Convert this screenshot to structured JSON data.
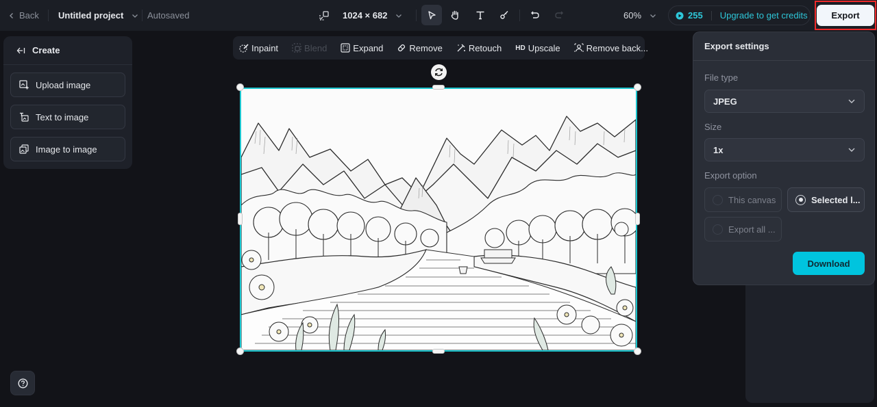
{
  "topbar": {
    "back_label": "Back",
    "project_title": "Untitled project",
    "autosave_status": "Autosaved",
    "canvas_size": "1024 × 682",
    "zoom_level": "60%",
    "credits_count": "255",
    "upgrade_label": "Upgrade to get credits",
    "export_label": "Export",
    "tools": [
      {
        "name": "select",
        "icon": "cursor-arrow-icon",
        "active": true
      },
      {
        "name": "hand",
        "icon": "hand-icon",
        "active": false
      },
      {
        "name": "text",
        "icon": "text-icon",
        "active": false
      },
      {
        "name": "brush",
        "icon": "brush-icon",
        "active": false
      },
      {
        "name": "undo",
        "icon": "undo-icon",
        "active": false
      },
      {
        "name": "redo",
        "icon": "redo-icon",
        "active": false,
        "disabled": true
      }
    ]
  },
  "left_panel": {
    "header": "Create",
    "items": [
      {
        "label": "Upload image",
        "icon": "upload-image-icon"
      },
      {
        "label": "Text to image",
        "icon": "text-to-image-icon"
      },
      {
        "label": "Image to image",
        "icon": "image-to-image-icon"
      }
    ]
  },
  "edit_toolbar": {
    "items": [
      {
        "label": "Inpaint",
        "icon": "inpaint-icon",
        "disabled": false
      },
      {
        "label": "Blend",
        "icon": "blend-icon",
        "disabled": true
      },
      {
        "label": "Expand",
        "icon": "expand-icon",
        "disabled": false
      },
      {
        "label": "Remove",
        "icon": "eraser-icon",
        "disabled": false
      },
      {
        "label": "Retouch",
        "icon": "retouch-wand-icon",
        "disabled": false
      },
      {
        "label": "Upscale",
        "icon": "hd-icon",
        "icon_text": "HD",
        "disabled": false
      },
      {
        "label": "Remove back...",
        "icon": "remove-background-icon",
        "disabled": false
      }
    ]
  },
  "canvas": {
    "image_description": "Line-art coloring page: mountains, forest, river with boats, flowers in foreground",
    "accent_color": "#1cc6cf"
  },
  "export_panel": {
    "title": "Export settings",
    "file_type_label": "File type",
    "file_type_value": "JPEG",
    "size_label": "Size",
    "size_value": "1x",
    "export_option_label": "Export option",
    "options": [
      {
        "label": "This canvas",
        "selected": false
      },
      {
        "label": "Selected l...",
        "selected": true
      },
      {
        "label": "Export all ...",
        "selected": false
      }
    ],
    "download_label": "Download"
  },
  "colors": {
    "accent": "#00c4de",
    "highlight": "#ef2a2a",
    "background": "#121318",
    "panel": "#1e2129"
  }
}
